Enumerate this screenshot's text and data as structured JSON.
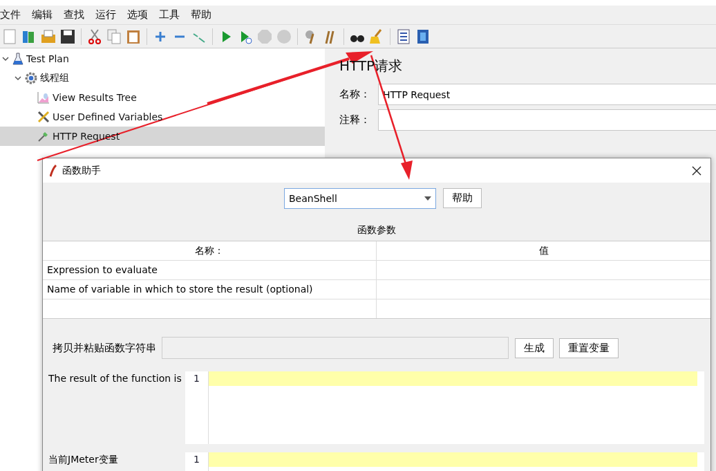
{
  "menu": [
    "文件",
    "编辑",
    "查找",
    "运行",
    "选项",
    "工具",
    "帮助"
  ],
  "tree": [
    {
      "label": "Test Plan",
      "kind": "plan",
      "expanded": true,
      "selected": false,
      "children": [
        {
          "label": "线程组",
          "kind": "threads",
          "expanded": true,
          "selected": false,
          "children": [
            {
              "label": "View Results Tree",
              "kind": "listener",
              "selected": false
            },
            {
              "label": "User Defined Variables",
              "kind": "config",
              "selected": false
            },
            {
              "label": "HTTP Request",
              "kind": "sampler",
              "selected": true
            }
          ]
        }
      ]
    }
  ],
  "editor": {
    "title": "HTTP请求",
    "fields": [
      {
        "label": "名称：",
        "value": "HTTP Request"
      },
      {
        "label": "注释："
      }
    ]
  },
  "dialog": {
    "title": "函数助手",
    "function": "BeanShell",
    "help_button": "帮助",
    "section_title": "函数参数",
    "columns": [
      "名称：",
      "值"
    ],
    "rows": [
      [
        "Expression to evaluate"
      ],
      [
        "Name of variable in which to store the result (optional)"
      ]
    ],
    "copy_label": "拷贝并粘贴函数字符串",
    "generate_button": "生成",
    "reset_button": "重置变量",
    "outputs": [
      {
        "label": "The result of the function is",
        "line": "1"
      },
      {
        "label": "当前JMeter变量",
        "line": "1"
      }
    ]
  }
}
